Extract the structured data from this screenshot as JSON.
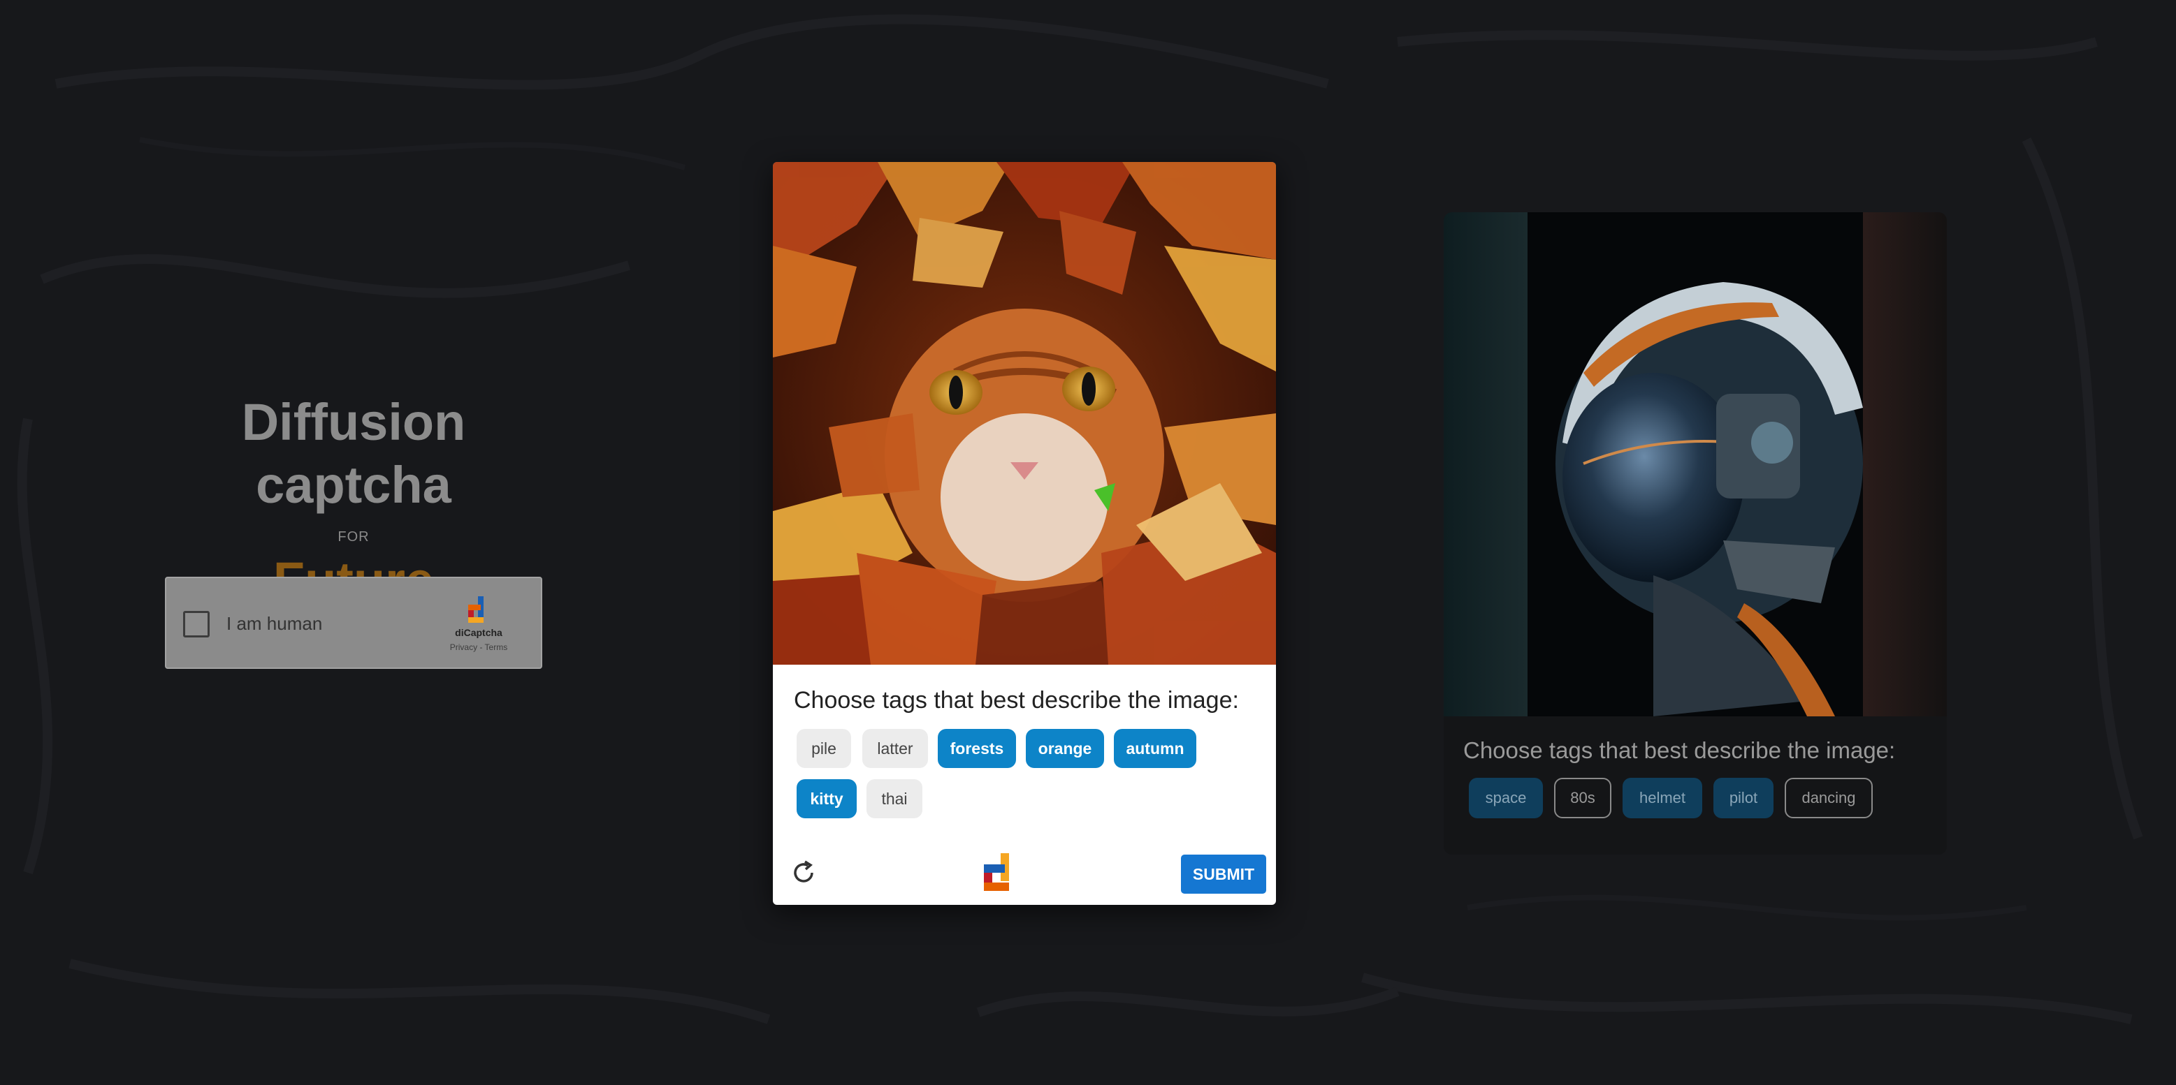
{
  "hero": {
    "title": "Diffusion captcha",
    "for_text": "FOR",
    "future": "Future"
  },
  "human_checkbox": {
    "label": "I am human",
    "checked": false,
    "brand": "diCaptcha",
    "links": "Privacy - Terms"
  },
  "main_card": {
    "prompt": "Choose tags that best describe the image:",
    "image_icon": "cat-in-autumn-leaves-image",
    "tags": [
      {
        "label": "pile",
        "selected": false
      },
      {
        "label": "latter",
        "selected": false
      },
      {
        "label": "forests",
        "selected": true
      },
      {
        "label": "orange",
        "selected": true
      },
      {
        "label": "autumn",
        "selected": true
      },
      {
        "label": "kitty",
        "selected": true
      },
      {
        "label": "thai",
        "selected": false
      }
    ],
    "refresh_icon": "refresh-icon",
    "submit_label": "SUBMIT"
  },
  "secondary_card": {
    "prompt": "Choose tags that best describe the image:",
    "image_icon": "astronaut-helmet-image",
    "tags": [
      {
        "label": "space",
        "selected": true
      },
      {
        "label": "80s",
        "selected": false
      },
      {
        "label": "helmet",
        "selected": true
      },
      {
        "label": "pilot",
        "selected": true
      },
      {
        "label": "dancing",
        "selected": false
      }
    ]
  },
  "colors": {
    "background": "#17181b",
    "selected_tag": "#0d84c8",
    "submit": "#1577d2",
    "future_accent": "#8a5a14"
  }
}
